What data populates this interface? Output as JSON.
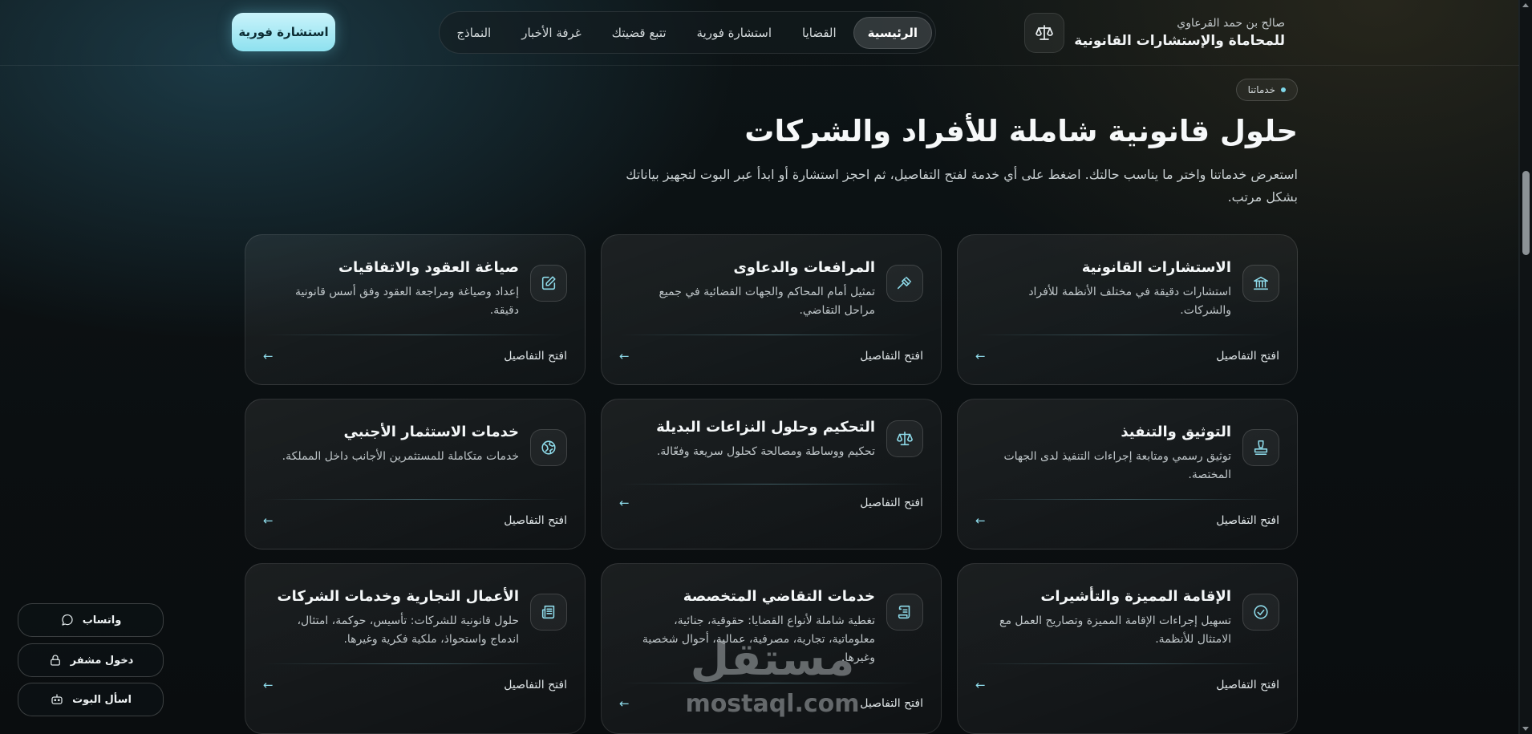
{
  "header": {
    "brand_name": "صالح بن حمد القرعاوي",
    "brand_title": "للمحاماة والإستشارات القانونية",
    "nav": [
      {
        "label": "الرئيسية",
        "active": true
      },
      {
        "label": "القضايا",
        "active": false
      },
      {
        "label": "استشارة فورية",
        "active": false
      },
      {
        "label": "تتبع قضيتك",
        "active": false
      },
      {
        "label": "غرفة الأخبار",
        "active": false
      },
      {
        "label": "النماذج",
        "active": false
      }
    ],
    "cta_label": "استشارة فورية"
  },
  "hero": {
    "pill": "خدماتنا",
    "title": "حلول قانونية شاملة للأفراد والشركات",
    "subtitle": "استعرض خدماتنا واختر ما يناسب حالتك. اضغط على أي خدمة لفتح التفاصيل، ثم احجز استشارة أو ابدأ عبر البوت لتجهيز بياناتك بشكل مرتب."
  },
  "services": [
    {
      "title": "الاستشارات القانونية",
      "desc": "استشارات دقيقة في مختلف الأنظمة للأفراد والشركات.",
      "link": "افتح التفاصيل",
      "icon": "bank-icon"
    },
    {
      "title": "المرافعات والدعاوى",
      "desc": "تمثيل أمام المحاكم والجهات القضائية في جميع مراحل التقاضي.",
      "link": "افتح التفاصيل",
      "icon": "gavel-icon"
    },
    {
      "title": "صياغة العقود والاتفاقيات",
      "desc": "إعداد وصياغة ومراجعة العقود وفق أسس قانونية دقيقة.",
      "link": "افتح التفاصيل",
      "icon": "edit-document-icon"
    },
    {
      "title": "التوثيق والتنفيذ",
      "desc": "توثيق رسمي ومتابعة إجراءات التنفيذ لدى الجهات المختصة.",
      "link": "افتح التفاصيل",
      "icon": "stamp-icon"
    },
    {
      "title": "التحكيم وحلول النزاعات البديلة",
      "desc": "تحكيم ووساطة ومصالحة كحلول سريعة وفعّالة.",
      "link": "افتح التفاصيل",
      "icon": "scale-icon"
    },
    {
      "title": "خدمات الاستثمار الأجنبي",
      "desc": "خدمات متكاملة للمستثمرين الأجانب داخل المملكة.",
      "link": "افتح التفاصيل",
      "icon": "globe-icon"
    },
    {
      "title": "الإقامة المميزة والتأشيرات",
      "desc": "تسهيل إجراءات الإقامة المميزة وتصاريح العمل مع الامتثال للأنظمة.",
      "link": "افتح التفاصيل",
      "icon": "badge-check-icon"
    },
    {
      "title": "خدمات التقاضي المتخصصة",
      "desc": "تغطية شاملة لأنواع القضايا: حقوقية، جنائية، معلوماتية، تجارية، مصرفية، عمالية، أحوال شخصية وغيرها.",
      "link": "افتح التفاصيل",
      "icon": "scroll-icon"
    },
    {
      "title": "الأعمال التجارية وخدمات الشركات",
      "desc": "حلول قانونية للشركات: تأسيس، حوكمة، امتثال، اندماج واستحواذ، ملكية فكرية وغيرها.",
      "link": "افتح التفاصيل",
      "icon": "newspaper-icon"
    }
  ],
  "floating": {
    "whatsapp": "واتساب",
    "secure_login": "دخول مشفر",
    "ask_bot": "اسأل البوت"
  },
  "watermark": {
    "ar": "مستقل",
    "en": "mostaql.com"
  }
}
